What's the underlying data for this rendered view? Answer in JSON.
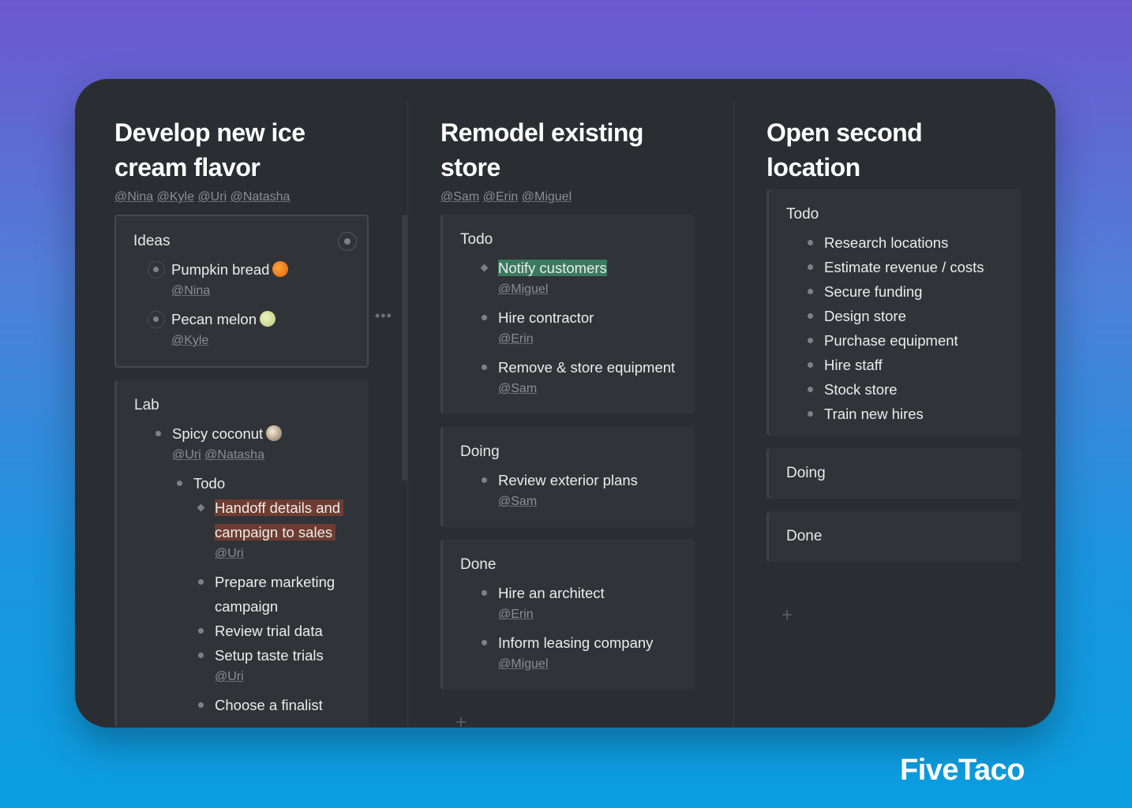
{
  "brand": "FiveTaco",
  "columns": [
    {
      "title": "Develop new ice cream flavor",
      "members": [
        "@Nina",
        "@Kyle",
        "@Uri",
        "@Natasha"
      ],
      "cards": [
        {
          "title": "Ideas",
          "selected": true,
          "items": [
            {
              "text": "Pumpkin bread",
              "emoji": "pumpkin-icon",
              "mention": [
                "@Nina"
              ],
              "bullet": "radio"
            },
            {
              "text": "Pecan melon",
              "emoji": "melon-icon",
              "mention": [
                "@Kyle"
              ],
              "bullet": "radio"
            }
          ]
        },
        {
          "title": "Lab",
          "items": [
            {
              "text": "Spicy coconut",
              "emoji": "coconut-icon",
              "mention": [
                "@Uri",
                "@Natasha"
              ]
            },
            {
              "text": "Todo",
              "level": 2
            },
            {
              "text": "Handoff details and campaign to sales",
              "level": 3,
              "highlight": "red",
              "bullet": "diamond",
              "mention": [
                "@Uri"
              ]
            },
            {
              "text": "Prepare marketing campaign",
              "level": 3
            },
            {
              "text": "Review trial data",
              "level": 3
            },
            {
              "text": "Setup taste trials",
              "level": 3,
              "mention": [
                "@Uri"
              ]
            },
            {
              "text": "Choose a finalist",
              "level": 3
            }
          ]
        }
      ]
    },
    {
      "title": "Remodel existing store",
      "members": [
        "@Sam",
        "@Erin",
        "@Miguel"
      ],
      "cards": [
        {
          "title": "Todo",
          "items": [
            {
              "text": "Notify customers",
              "highlight": "green",
              "bullet": "diamond",
              "mention": [
                "@Miguel"
              ]
            },
            {
              "text": "Hire contractor",
              "mention": [
                "@Erin"
              ]
            },
            {
              "text": "Remove & store equipment",
              "mention": [
                "@Sam"
              ]
            }
          ]
        },
        {
          "title": "Doing",
          "items": [
            {
              "text": "Review exterior plans",
              "mention": [
                "@Sam"
              ]
            }
          ]
        },
        {
          "title": "Done",
          "items": [
            {
              "text": "Hire an architect",
              "mention": [
                "@Erin"
              ]
            },
            {
              "text": "Inform leasing company",
              "mention": [
                "@Miguel"
              ]
            }
          ]
        }
      ]
    },
    {
      "title": "Open second location",
      "members": [],
      "cards": [
        {
          "title": "Todo",
          "items": [
            {
              "text": "Research locations"
            },
            {
              "text": "Estimate revenue / costs"
            },
            {
              "text": "Secure funding"
            },
            {
              "text": "Design store"
            },
            {
              "text": "Purchase equipment"
            },
            {
              "text": "Hire staff"
            },
            {
              "text": "Stock store"
            },
            {
              "text": "Train new hires"
            }
          ]
        },
        {
          "title": "Doing",
          "items": []
        },
        {
          "title": "Done",
          "items": []
        }
      ]
    }
  ],
  "colors": {
    "green_highlight": "#3b7a5f",
    "red_highlight": "#6e3c30",
    "panel": "#2a2d31",
    "card": "#303338"
  }
}
